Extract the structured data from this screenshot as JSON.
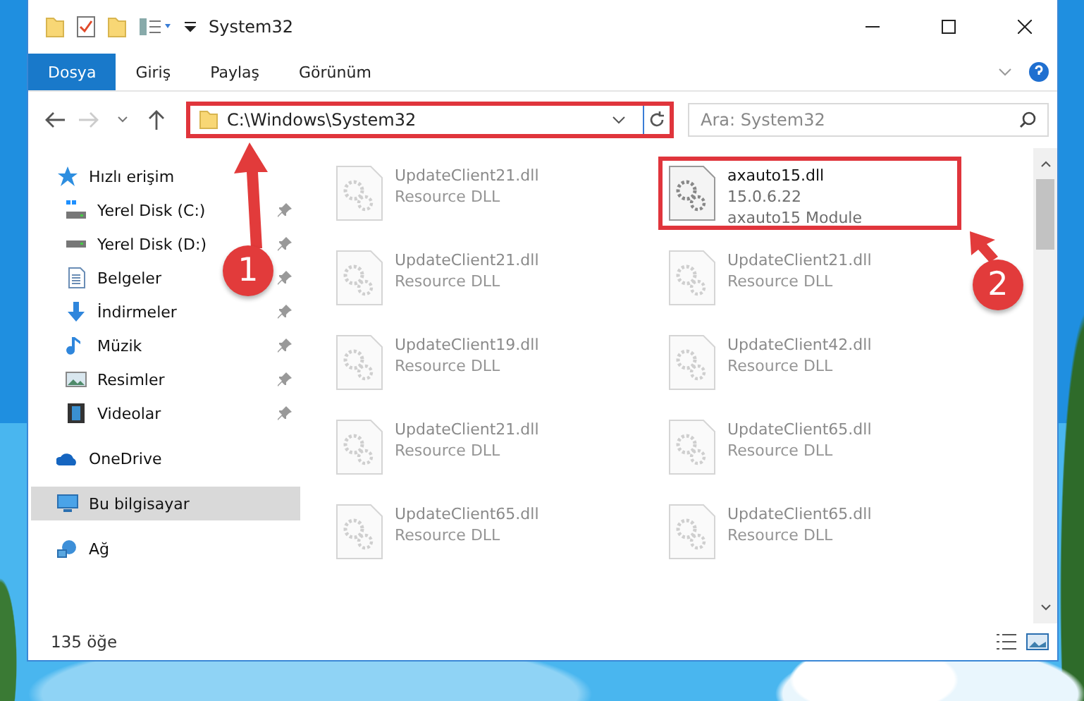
{
  "window": {
    "title": "System32"
  },
  "ribbon_tabs": [
    {
      "label": "Dosya",
      "selected": true
    },
    {
      "label": "Giriş",
      "selected": false
    },
    {
      "label": "Paylaş",
      "selected": false
    },
    {
      "label": "Görünüm",
      "selected": false
    }
  ],
  "address": {
    "path": "C:\\Windows\\System32",
    "highlighted": true
  },
  "search": {
    "placeholder": "Ara: System32"
  },
  "nav": [
    {
      "label": "Hızlı erişim",
      "kind": "star",
      "selected": false,
      "children": [
        {
          "label": "Yerel Disk (C:)",
          "kind": "drive-win",
          "pinned": true
        },
        {
          "label": "Yerel Disk (D:)",
          "kind": "drive",
          "pinned": true
        },
        {
          "label": "Belgeler",
          "kind": "document",
          "pinned": true
        },
        {
          "label": "İndirmeler",
          "kind": "download",
          "pinned": true
        },
        {
          "label": "Müzik",
          "kind": "music",
          "pinned": true
        },
        {
          "label": "Resimler",
          "kind": "image",
          "pinned": true
        },
        {
          "label": "Videolar",
          "kind": "film",
          "pinned": true
        }
      ]
    },
    {
      "label": "OneDrive",
      "kind": "cloud",
      "selected": false
    },
    {
      "label": "Bu bilgisayar",
      "kind": "computer",
      "selected": true
    },
    {
      "label": "Ağ",
      "kind": "network",
      "selected": false
    }
  ],
  "files": [
    {
      "name": "UpdateClient21.dll",
      "details": [
        "Resource DLL"
      ],
      "blurred": true,
      "highlighted": false
    },
    {
      "name": "axauto15.dll",
      "details": [
        "15.0.6.22",
        "axauto15 Module"
      ],
      "blurred": false,
      "highlighted": true
    },
    {
      "name": "UpdateClient21.dll",
      "details": [
        "Resource DLL"
      ],
      "blurred": true,
      "highlighted": false
    },
    {
      "name": "UpdateClient21.dll",
      "details": [
        "Resource DLL"
      ],
      "blurred": true,
      "highlighted": false
    },
    {
      "name": "UpdateClient19.dll",
      "details": [
        "Resource DLL"
      ],
      "blurred": true,
      "highlighted": false
    },
    {
      "name": "UpdateClient42.dll",
      "details": [
        "Resource DLL"
      ],
      "blurred": true,
      "highlighted": false
    },
    {
      "name": "UpdateClient21.dll",
      "details": [
        "Resource DLL"
      ],
      "blurred": true,
      "highlighted": false
    },
    {
      "name": "UpdateClient65.dll",
      "details": [
        "Resource DLL"
      ],
      "blurred": true,
      "highlighted": false
    },
    {
      "name": "UpdateClient65.dll",
      "details": [
        "Resource DLL"
      ],
      "blurred": true,
      "highlighted": false
    },
    {
      "name": "UpdateClient65.dll",
      "details": [
        "Resource DLL"
      ],
      "blurred": true,
      "highlighted": false
    }
  ],
  "status_bar": {
    "count": "135 öğe"
  },
  "callouts": [
    {
      "number": "1"
    },
    {
      "number": "2"
    }
  ]
}
